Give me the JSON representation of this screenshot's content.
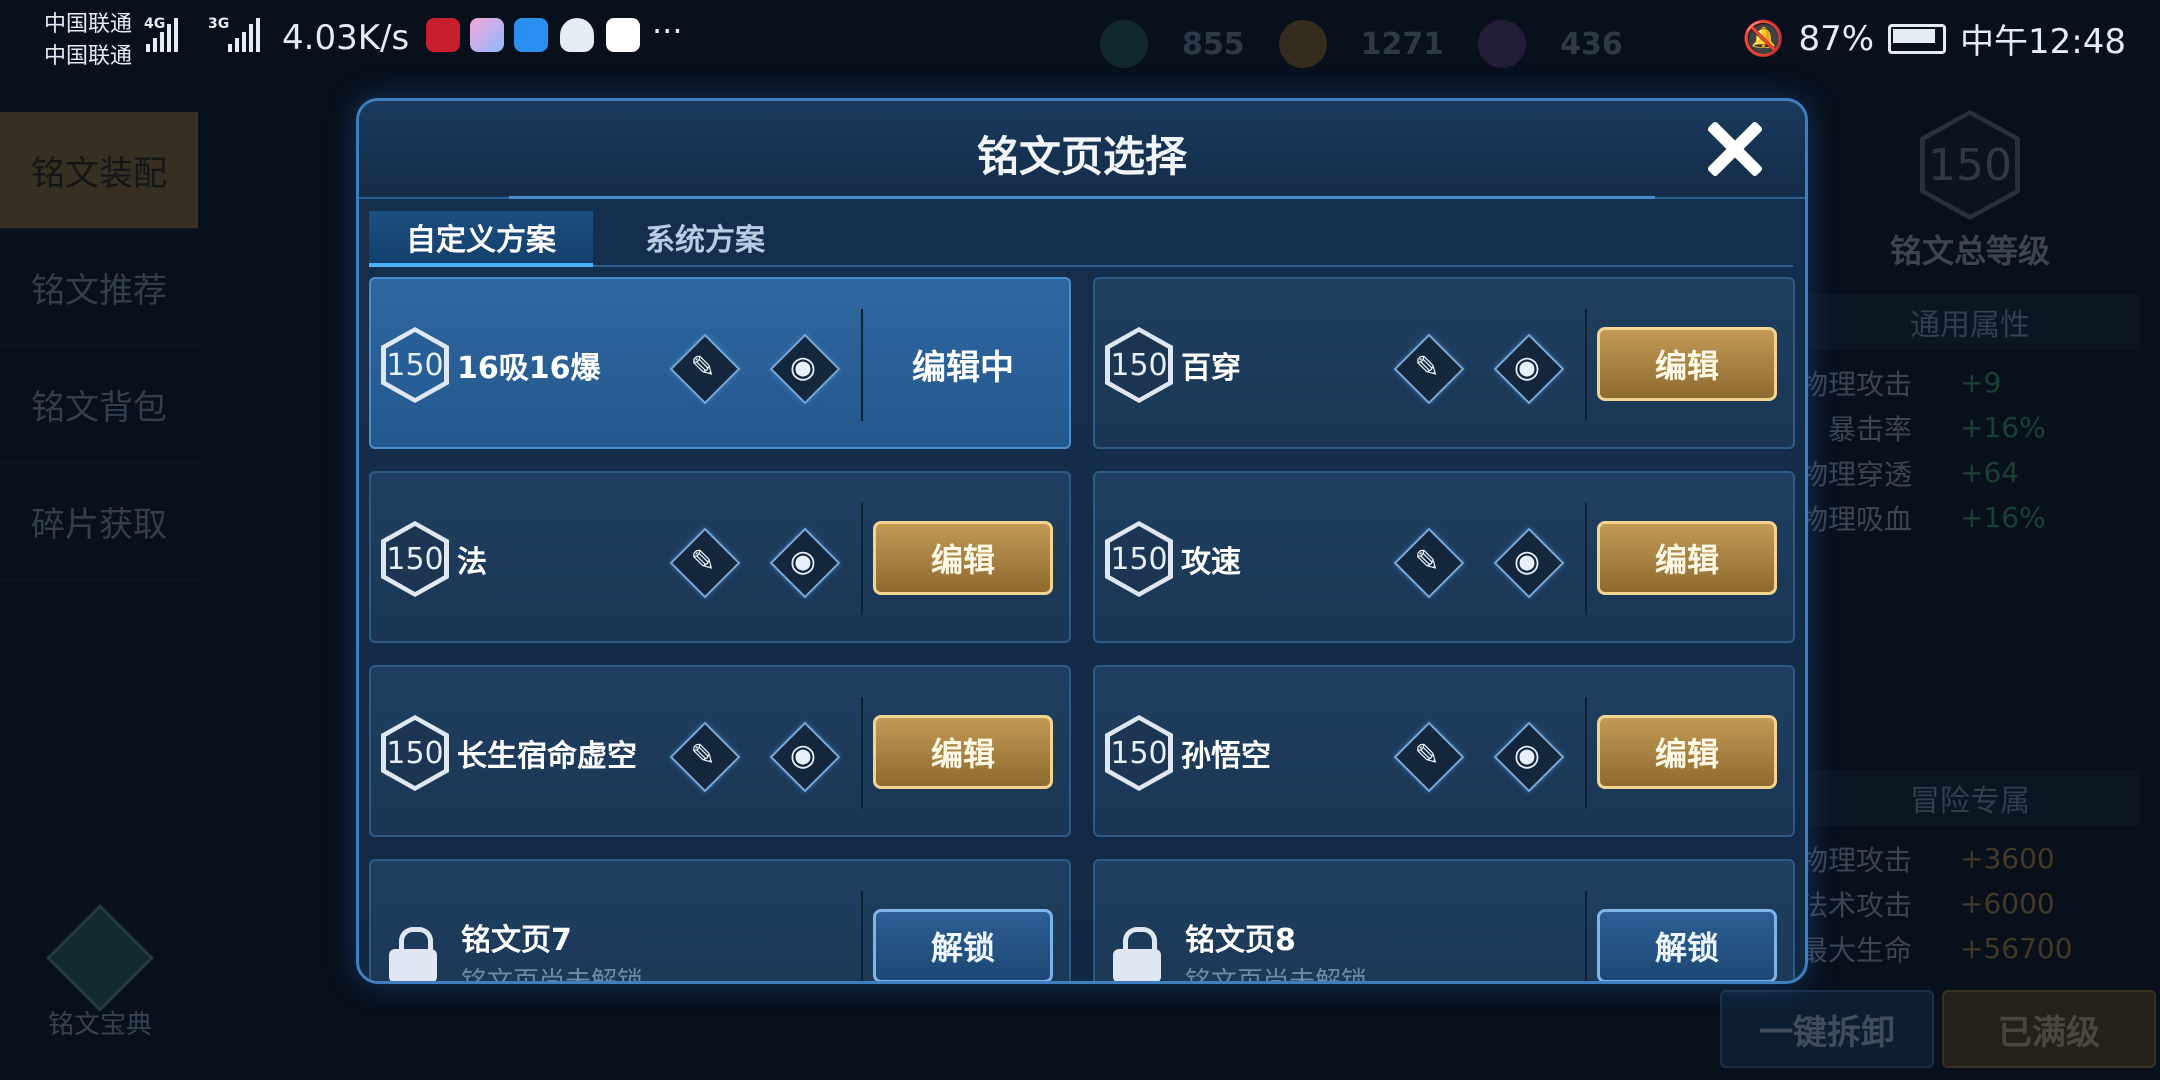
{
  "status_bar": {
    "carrier_1": "中国联通",
    "carrier_2": "中国联通",
    "net_1": "4G",
    "net_2": "3G",
    "speed": "4.03K/s",
    "more": "···",
    "battery": "87%",
    "time": "中午12:48"
  },
  "currency": [
    {
      "icon": "crystal-icon",
      "value": "855"
    },
    {
      "icon": "gold-coin-icon",
      "value": "1271"
    },
    {
      "icon": "gem-icon",
      "value": "436"
    }
  ],
  "left_nav": [
    "铭文装配",
    "铭文推荐",
    "铭文背包",
    "碎片获取"
  ],
  "codex_label": "铭文宝典",
  "right_panel": {
    "total_level": "150",
    "total_level_label": "铭文总等级",
    "general_title": "通用属性",
    "general_attrs": [
      {
        "name": "物理攻击",
        "value": "+9"
      },
      {
        "name": "暴击率",
        "value": "+16%"
      },
      {
        "name": "物理穿透",
        "value": "+64"
      },
      {
        "name": "物理吸血",
        "value": "+16%"
      }
    ],
    "adventure_title": "冒险专属",
    "adventure_attrs": [
      {
        "name": "物理攻击",
        "value": "+3600"
      },
      {
        "name": "法术攻击",
        "value": "+6000"
      },
      {
        "name": "最大生命",
        "value": "+56700"
      }
    ],
    "dismantle_label": "一键拆卸",
    "maxed_label": "已满级"
  },
  "modal": {
    "title": "铭文页选择",
    "tabs": [
      "自定义方案",
      "系统方案"
    ],
    "pages": [
      {
        "level": "150",
        "name": "16吸16爆",
        "state": "编辑中"
      },
      {
        "level": "150",
        "name": "百穿",
        "action": "编辑"
      },
      {
        "level": "150",
        "name": "法",
        "action": "编辑"
      },
      {
        "level": "150",
        "name": "攻速",
        "action": "编辑"
      },
      {
        "level": "150",
        "name": "长生宿命虚空",
        "action": "编辑"
      },
      {
        "level": "150",
        "name": "孙悟空",
        "action": "编辑"
      }
    ],
    "locked": [
      {
        "name": "铭文页7",
        "hint": "铭文页尚未解锁",
        "action": "解锁"
      },
      {
        "name": "铭文页8",
        "hint": "铭文页尚未解锁",
        "action": "解锁"
      }
    ]
  },
  "colors": {
    "accent_gold": "#c29a56",
    "accent_blue": "#3f7fc0",
    "bg": "#0b1421"
  }
}
